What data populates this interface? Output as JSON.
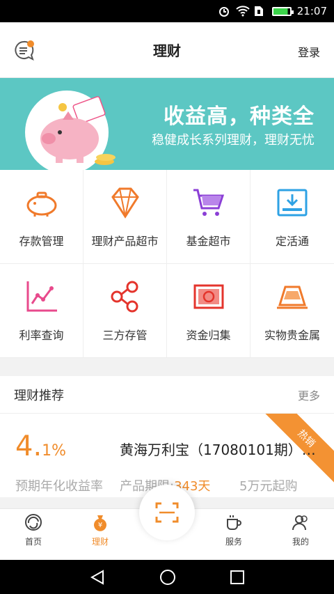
{
  "status_bar": {
    "time": "21:07"
  },
  "header": {
    "title": "理财",
    "login_label": "登录"
  },
  "banner": {
    "headline": "收益高，种类全",
    "subline": "稳健成长系列理财，理财无忧"
  },
  "grid": {
    "items": [
      {
        "label": "存款管理",
        "icon": "piggy-bank-icon"
      },
      {
        "label": "理财产品超市",
        "icon": "diamond-icon"
      },
      {
        "label": "基金超市",
        "icon": "shopping-cart-icon"
      },
      {
        "label": "定活通",
        "icon": "download-box-icon"
      },
      {
        "label": "利率查询",
        "icon": "line-chart-icon"
      },
      {
        "label": "三方存管",
        "icon": "share-nodes-icon"
      },
      {
        "label": "资金归集",
        "icon": "money-note-icon"
      },
      {
        "label": "实物贵金属",
        "icon": "gold-bar-icon"
      }
    ]
  },
  "recommend": {
    "title": "理财推荐",
    "more_label": "更多",
    "product": {
      "rate_main": "4.",
      "rate_small": "1%",
      "name": "黄海万利宝（17080101期）7...",
      "rate_label": "预期年化收益率",
      "term_label": "产品期限:",
      "term_value": "343天",
      "min_label": "5万元起购",
      "badge": "热销"
    }
  },
  "bottom_nav": {
    "home": "首页",
    "finance": "理财",
    "service": "服务",
    "mine": "我的"
  },
  "colors": {
    "accent": "#f08c2b",
    "banner": "#5cc7c3"
  }
}
